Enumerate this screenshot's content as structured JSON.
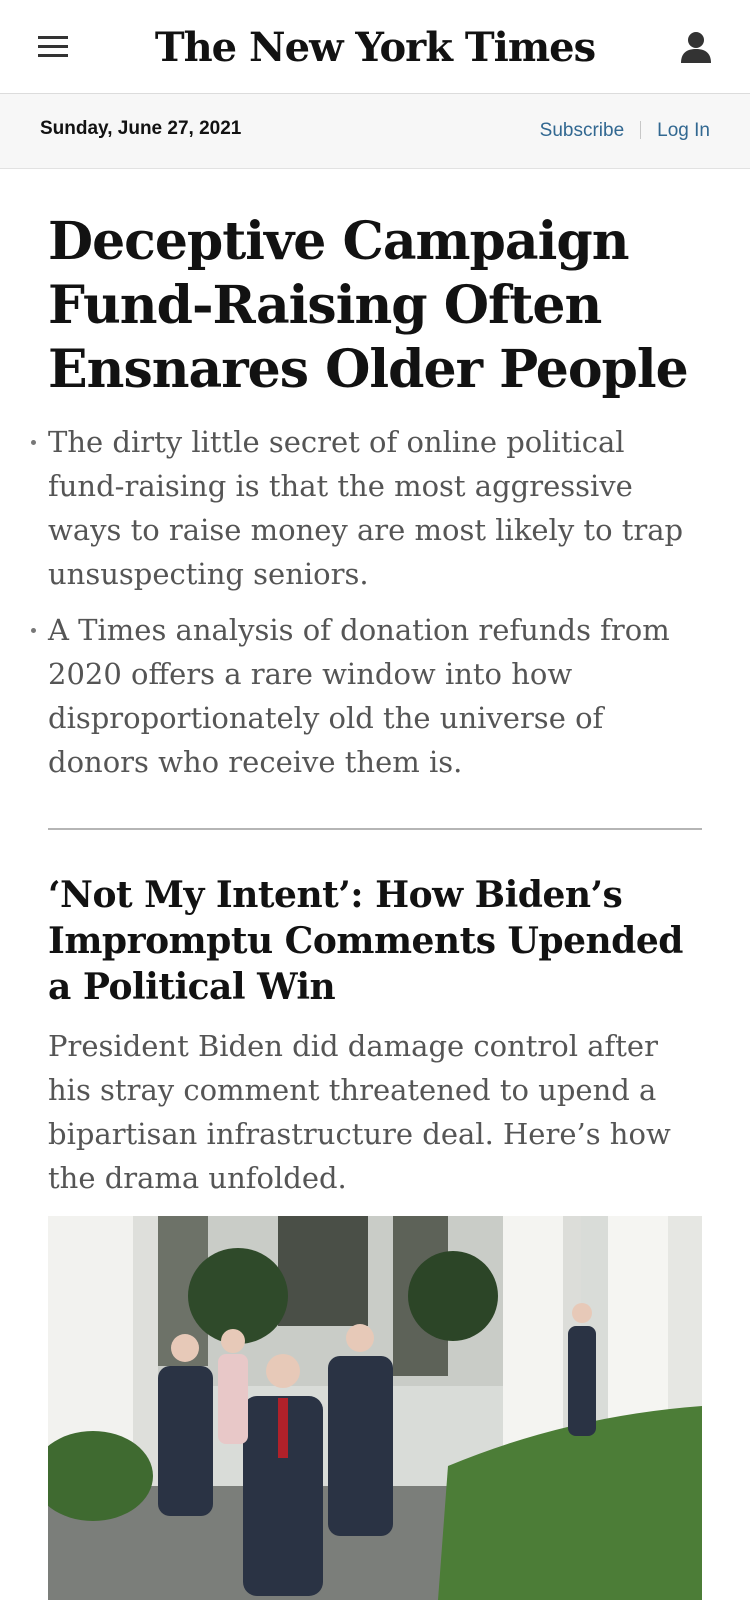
{
  "masthead": {
    "logo": "The New York Times",
    "menu_icon": "menu-icon",
    "account_icon": "user-icon"
  },
  "datebar": {
    "date": "Sunday, June 27, 2021",
    "subscribe": "Subscribe",
    "login": "Log In"
  },
  "lead": {
    "headline": "Deceptive Campaign Fund-Raising Often Ensnares Older People",
    "bullets": [
      "The dirty little secret of online political fund-raising is that the most aggressive ways to raise money are most likely to trap unsuspecting seniors.",
      "A Times analysis of donation refunds from 2020 offers a rare window into how disproportionately old the universe of donors who receive them is."
    ]
  },
  "story2": {
    "headline": "‘Not My Intent’: How Biden’s Impromptu Comments Upended a Political Win",
    "summary": "President Biden did damage control after his stray comment threatened to upend a bipartisan infrastructure deal. Here’s how the drama unfolded."
  },
  "colors": {
    "link": "#326891",
    "text": "#121212",
    "summary": "#555555"
  }
}
